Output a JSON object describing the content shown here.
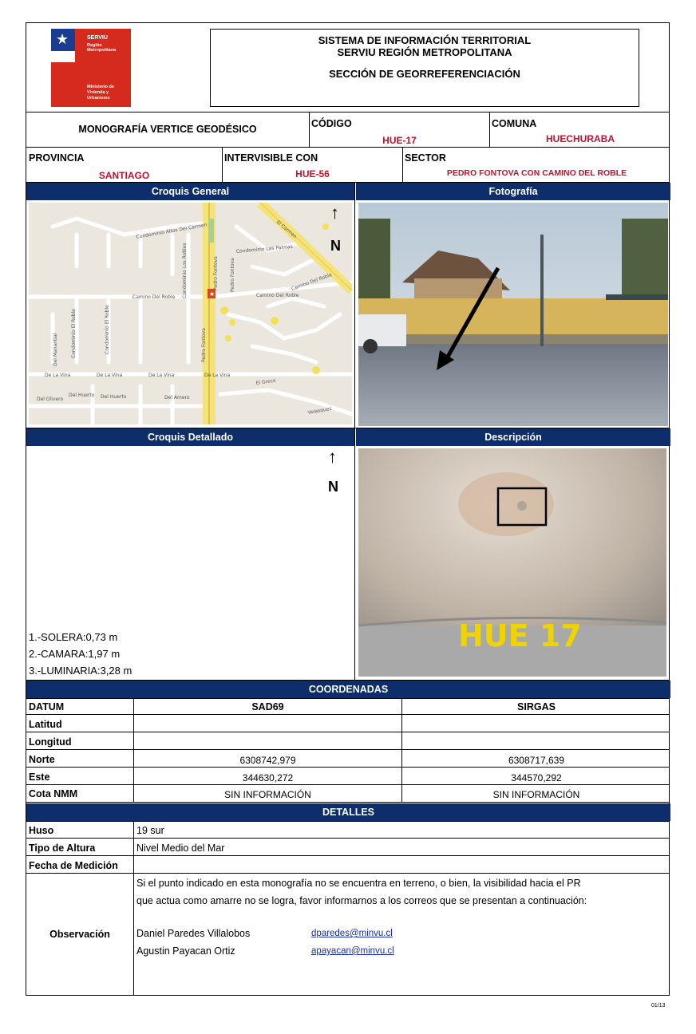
{
  "header": {
    "logo_top": "SERVIU",
    "logo_sub": "Región Metropolitana",
    "logo_ministry": "Ministerio de Vivienda y Urbanismo",
    "title_line1": "SISTEMA DE INFORMACIÓN TERRITORIAL",
    "title_line2": "SERVIU REGIÓN METROPOLITANA",
    "title_line3": "SECCIÓN  DE GEORREFERENCIACIÓN"
  },
  "info": {
    "monografia": "MONOGRAFÍA VERTICE GEODÉSICO",
    "codigo_label": "CÓDIGO",
    "codigo_value": "HUE-17",
    "comuna_label": "COMUNA",
    "comuna_value": "HUECHURABA",
    "provincia_label": "PROVINCIA",
    "provincia_value": "SANTIAGO",
    "intervisible_label": "INTERVISIBLE CON",
    "intervisible_value": "HUE-56",
    "sector_label": "SECTOR",
    "sector_value": "PEDRO FONTOVA CON CAMINO DEL ROBLE"
  },
  "sections": {
    "croquis_general": "Croquis General",
    "fotografia": "Fotografía",
    "croquis_detallado": "Croquis Detallado",
    "descripcion": "Descripción",
    "coordenadas": "COORDENADAS",
    "detalles": "DETALLES"
  },
  "map": {
    "north": "N",
    "streets": [
      "Condominio Altos Del Carmen",
      "El Carmen",
      "Condominio Las Palmas",
      "Camino Del Roble",
      "Pedro Fontova",
      "Condominio Los Robles",
      "Condominio El Roble",
      "Del Manantial",
      "De La Vina",
      "Del Huerto",
      "Del Olivero",
      "Del Arroyo",
      "Del Amero",
      "El Greco",
      "Velasquez",
      "Camino Del Roble"
    ]
  },
  "detallado": {
    "north": "N",
    "notes": [
      "1.-SOLERA:0,73 m",
      "2.-CAMARA:1,97 m",
      "3.-LUMINARIA:3,28 m"
    ]
  },
  "descripcion_photo": {
    "painted_text": "HUE 17"
  },
  "coords": {
    "datum_label": "DATUM",
    "col1": "SAD69",
    "col2": "SIRGAS",
    "rows": [
      {
        "label": "Latitud",
        "v1": "",
        "v2": ""
      },
      {
        "label": "Longitud",
        "v1": "",
        "v2": ""
      },
      {
        "label": "Norte",
        "v1": "6308742,979",
        "v2": "6308717,639"
      },
      {
        "label": "Este",
        "v1": "344630,272",
        "v2": "344570,292"
      },
      {
        "label": "Cota NMM",
        "v1": "SIN INFORMACIÓN",
        "v2": "SIN INFORMACIÓN"
      }
    ]
  },
  "details": {
    "huso_label": "Huso",
    "huso_value": "19 sur",
    "altura_label": "Tipo de Altura",
    "altura_value": "Nivel Medio del Mar",
    "fecha_label": "Fecha de Medición",
    "fecha_value": "",
    "obs_label": "Observación",
    "obs_line1": "Si el punto indicado en esta monografía no se encuentra en terreno, o bien, la visibilidad hacia el PR",
    "obs_line2": "que actua como amarre no se logra, favor informarnos a los correos que se presentan a continuación:",
    "contacts": [
      {
        "name": "Daniel Paredes Villalobos",
        "email": "dparedes@minvu.cl"
      },
      {
        "name": "Agustin Payacan Ortiz",
        "email": "apayacan@minvu.cl"
      }
    ]
  },
  "footer": {
    "page": "01/13"
  },
  "colors": {
    "bar": "#0d2d6b",
    "red_text": "#c8102e",
    "logo_blue": "#1a3d8f",
    "logo_red": "#d52b1e"
  }
}
